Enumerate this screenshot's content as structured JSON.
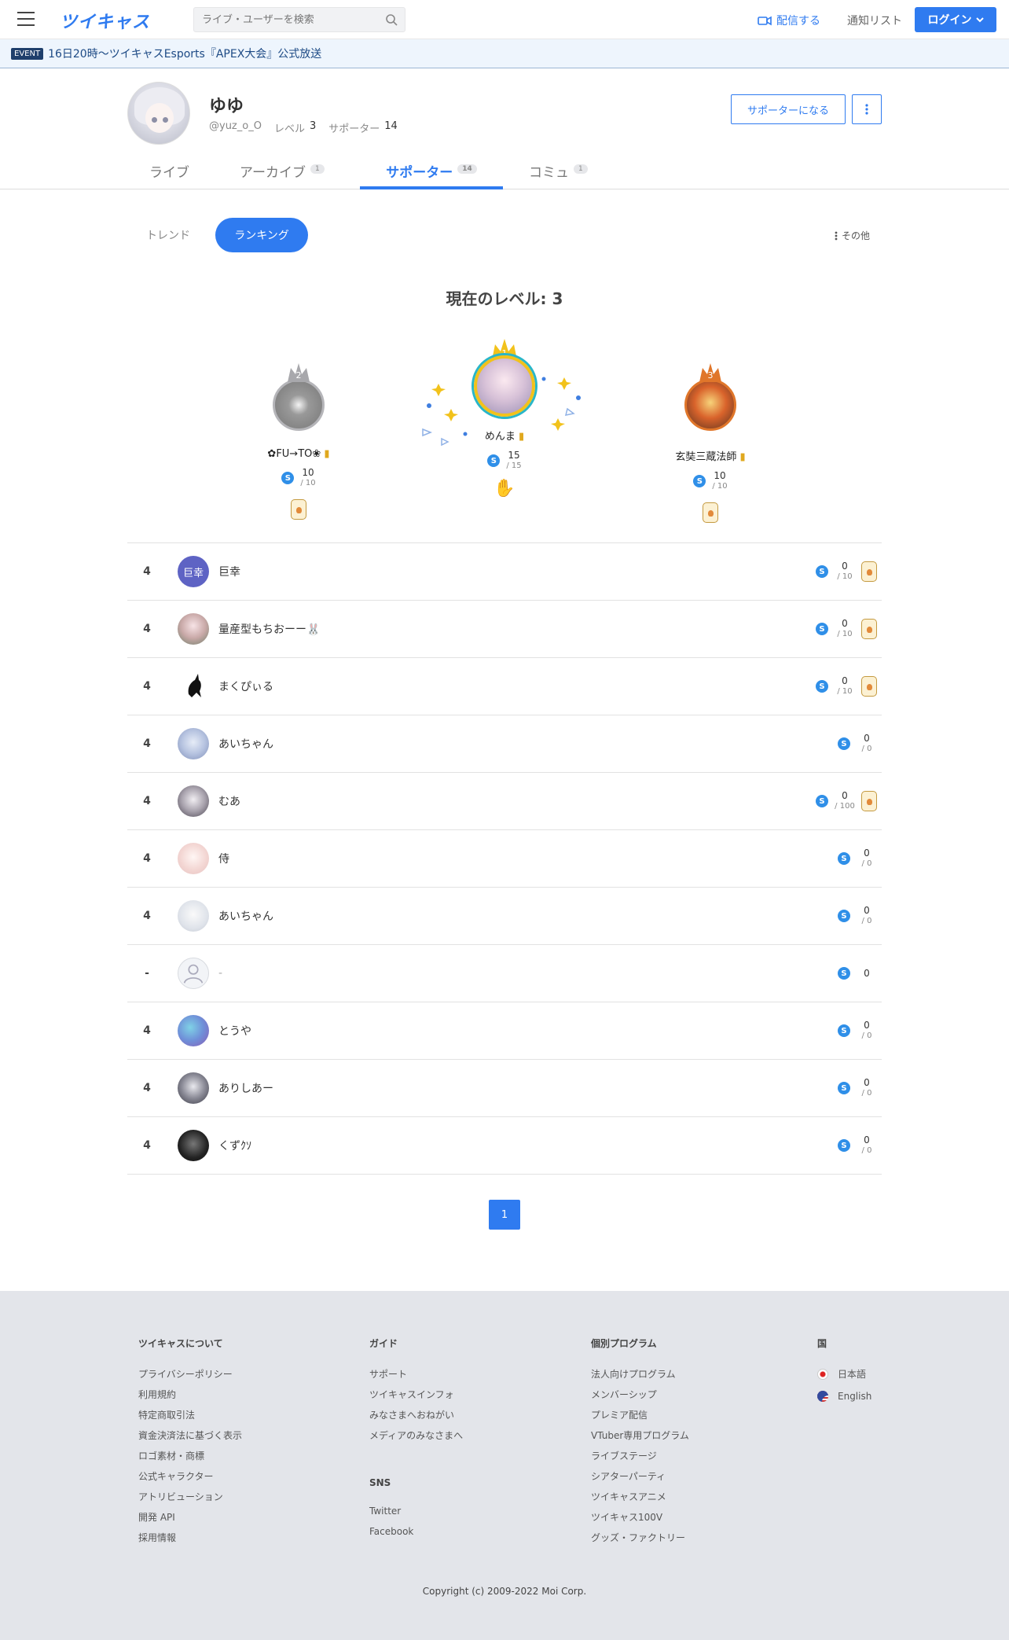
{
  "header": {
    "logo": "ツイキャス",
    "search_placeholder": "ライブ・ユーザーを検索",
    "broadcast_label": "配信する",
    "notify_label": "通知リスト",
    "login_label": "ログイン"
  },
  "event": {
    "badge": "EVENT",
    "text": "16日20時〜ツイキャスEsports『APEX大会』公式放送"
  },
  "profile": {
    "name": "ゆゆ",
    "handle": "@yuz_o_O",
    "level_label": "レベル",
    "level": "3",
    "supporter_label": "サポーター",
    "supporter_count": "14",
    "become_supporter": "サポーターになる"
  },
  "tabs": [
    {
      "label": "ライブ",
      "count": ""
    },
    {
      "label": "アーカイブ",
      "count": "1"
    },
    {
      "label": "サポーター",
      "count": "14"
    },
    {
      "label": "コミュ",
      "count": "1"
    }
  ],
  "subnav": {
    "trend": "トレンド",
    "ranking": "ランキング",
    "other": "その他"
  },
  "level_title": "現在のレベル: 3",
  "podium": [
    {
      "rank": "1",
      "name": "めんま",
      "score": "15",
      "max": "/ 15"
    },
    {
      "rank": "2",
      "name": "✿FU→TO❀",
      "score": "10",
      "max": "/ 10"
    },
    {
      "rank": "3",
      "name": "玄奘三蔵法師",
      "score": "10",
      "max": "/ 10"
    }
  ],
  "rows": [
    {
      "rank": "4",
      "name": "巨幸",
      "score": "0",
      "max": "/ 10",
      "badge": true
    },
    {
      "rank": "4",
      "name": "量産型もちおーー🐰",
      "score": "0",
      "max": "/ 10",
      "badge": true
    },
    {
      "rank": "4",
      "name": "まくぴぃる",
      "score": "0",
      "max": "/ 10",
      "badge": true
    },
    {
      "rank": "4",
      "name": "あいちゃん",
      "score": "0",
      "max": "/ 0",
      "badge": false
    },
    {
      "rank": "4",
      "name": "むあ",
      "score": "0",
      "max": "/ 100",
      "badge": true
    },
    {
      "rank": "4",
      "name": "侍",
      "score": "0",
      "max": "/ 0",
      "badge": false
    },
    {
      "rank": "4",
      "name": "あいちゃん",
      "score": "0",
      "max": "/ 0",
      "badge": false
    },
    {
      "rank": "-",
      "name": "-",
      "score": "0",
      "max": "",
      "badge": false
    },
    {
      "rank": "4",
      "name": "とうや",
      "score": "0",
      "max": "/ 0",
      "badge": false
    },
    {
      "rank": "4",
      "name": "ありしあー",
      "score": "0",
      "max": "/ 0",
      "badge": false
    },
    {
      "rank": "4",
      "name": "くずｸｿ",
      "score": "0",
      "max": "/ 0",
      "badge": false
    }
  ],
  "avatar_kanji": "巨幸",
  "coin_symbol": "S",
  "pager": "1",
  "footer": {
    "col1": {
      "title": "ツイキャスについて",
      "links": [
        "プライバシーポリシー",
        "利用規約",
        "特定商取引法",
        "資金決済法に基づく表示",
        "ロゴ素材・商標",
        "公式キャラクター",
        "アトリビューション",
        "開発 API",
        "採用情報"
      ]
    },
    "col2": {
      "title": "ガイド",
      "links": [
        "サポート",
        "ツイキャスインフォ",
        "みなさまへおねがい",
        "メディアのみなさまへ"
      ]
    },
    "col2b": {
      "title": "SNS",
      "links": [
        "Twitter",
        "Facebook"
      ]
    },
    "col3": {
      "title": "個別プログラム",
      "links": [
        "法人向けプログラム",
        "メンバーシップ",
        "プレミア配信",
        "VTuber専用プログラム",
        "ライブステージ",
        "シアターパーティ",
        "ツイキャスアニメ",
        "ツイキャス100V",
        "グッズ・ファクトリー"
      ]
    },
    "col4": {
      "title": "国",
      "links": [
        "日本語",
        "English"
      ]
    },
    "copyright": "Copyright (c) 2009-2022 Moi Corp."
  },
  "colors": {
    "accent": "#2f7bf0",
    "gold": "#f2c21b",
    "silver": "#a8a8ac",
    "bronze": "#e0762a"
  }
}
